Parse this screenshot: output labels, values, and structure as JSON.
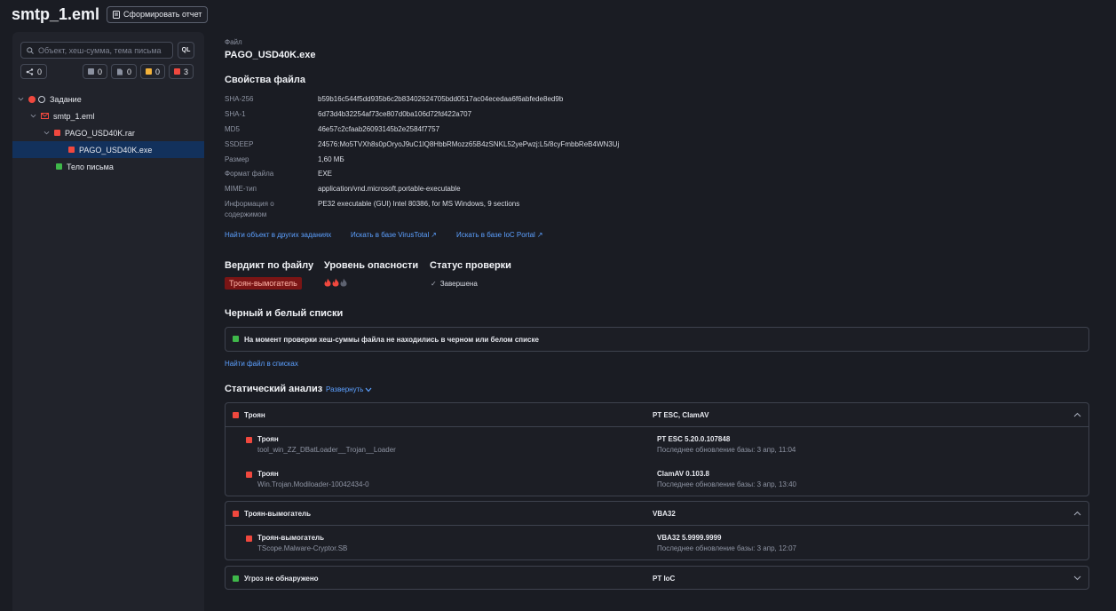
{
  "header": {
    "title": "smtp_1.eml",
    "report_button": "Сформировать отчет"
  },
  "sidebar": {
    "search_placeholder": "Объект, хеш-сумма, тема письма",
    "ql": "QL",
    "chips": [
      {
        "icon": "tree-icon",
        "count": "0"
      },
      {
        "icon": "gray-square",
        "count": "0"
      },
      {
        "icon": "doc-icon",
        "count": "0"
      },
      {
        "icon": "yellow-square",
        "count": "0"
      },
      {
        "icon": "red-square",
        "count": "3"
      }
    ],
    "tree": [
      {
        "label": "Задание",
        "level": 0,
        "status": "red"
      },
      {
        "label": "smtp_1.eml",
        "level": 1,
        "status": "mail"
      },
      {
        "label": "PAGO_USD40K.rar",
        "level": 2,
        "status": "red"
      },
      {
        "label": "PAGO_USD40K.exe",
        "level": 3,
        "status": "red",
        "selected": true
      },
      {
        "label": "Тело письма",
        "level": 2,
        "status": "green"
      }
    ]
  },
  "file": {
    "label": "Файл",
    "name": "PAGO_USD40K.exe",
    "props_title": "Свойства файла",
    "props": [
      {
        "k": "SHA-256",
        "v": "b59b16c544f5dd935b6c2b83402624705bdd0517ac04ecedaa6f6abfede8ed9b"
      },
      {
        "k": "SHA-1",
        "v": "6d73d4b32254af73ce807d0ba106d72fd422a707"
      },
      {
        "k": "MD5",
        "v": "46e57c2cfaab26093145b2e2584f7757"
      },
      {
        "k": "SSDEEP",
        "v": "24576:Mo5TVXh8s0pOryoJ9uC1lQ8HbbRMozz65B4zSNKL52yePwzj:L5/8cyFmbbReB4WN3Uj"
      },
      {
        "k": "Размер",
        "v": "1,60 МБ"
      },
      {
        "k": "Формат файла",
        "v": "EXE"
      },
      {
        "k": "MIME-тип",
        "v": "application/vnd.microsoft.portable-executable"
      },
      {
        "k": "Информация о содержимом",
        "v": "PE32 executable (GUI) Intel 80386, for MS Windows, 9 sections"
      }
    ],
    "links": [
      "Найти объект в других заданиях",
      "Искать в базе VirusTotal",
      "Искать в базе IoC Portal"
    ]
  },
  "verdict": {
    "verdict_title": "Вердикт по файлу",
    "danger_title": "Уровень опасности",
    "status_title": "Статус проверки",
    "verdict_value": "Троян-вымогатель",
    "danger_level": 2,
    "danger_max": 3,
    "status_value": "Завершена"
  },
  "lists": {
    "title": "Черный и белый списки",
    "message": "На момент проверки хеш-суммы файла не находились в черном или белом списке",
    "find_link": "Найти файл в списках"
  },
  "static": {
    "title": "Статический анализ",
    "expand": "Развернуть",
    "groups": [
      {
        "name": "Троян",
        "sources": "PT ESC, ClamAV",
        "status": "red",
        "rows": [
          {
            "t1": "Троян",
            "t2": "tool_win_ZZ_DBatLoader__Trojan__Loader",
            "e1": "PT ESC 5.20.0.107848",
            "e2": "Последнее обновление базы: 3 апр, 11:04"
          },
          {
            "t1": "Троян",
            "t2": "Win.Trojan.Modiloader-10042434-0",
            "e1": "ClamAV 0.103.8",
            "e2": "Последнее обновление базы: 3 апр, 13:40"
          }
        ]
      },
      {
        "name": "Троян-вымогатель",
        "sources": "VBA32",
        "status": "red",
        "rows": [
          {
            "t1": "Троян-вымогатель",
            "t2": "TScope.Malware-Cryptor.SB",
            "e1": "VBA32 5.9999.9999",
            "e2": "Последнее обновление базы: 3 апр, 12:07"
          }
        ]
      },
      {
        "name": "Угроз не обнаружено",
        "sources": "PT IoC",
        "status": "green",
        "rows": []
      }
    ]
  }
}
